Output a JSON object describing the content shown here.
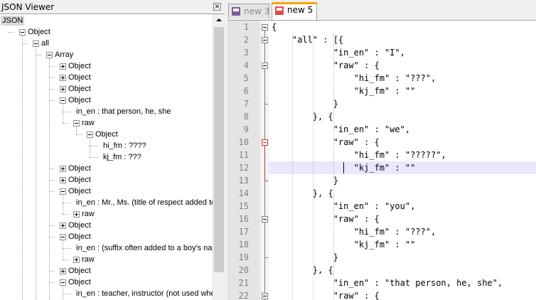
{
  "json_viewer": {
    "title": "JSON Viewer",
    "close_glyph": "×",
    "tree": [
      {
        "label": "JSON",
        "depth": 0,
        "toggle": "none",
        "root": true
      },
      {
        "label": "Object",
        "depth": 1,
        "toggle": "minus"
      },
      {
        "label": "all",
        "depth": 2,
        "toggle": "minus"
      },
      {
        "label": "Array",
        "depth": 3,
        "toggle": "minus"
      },
      {
        "label": "Object",
        "depth": 4,
        "toggle": "plus"
      },
      {
        "label": "Object",
        "depth": 4,
        "toggle": "plus"
      },
      {
        "label": "Object",
        "depth": 4,
        "toggle": "plus"
      },
      {
        "label": "Object",
        "depth": 4,
        "toggle": "minus"
      },
      {
        "label": "in_en : that person, he, she",
        "depth": 5,
        "toggle": "none"
      },
      {
        "label": "raw",
        "depth": 5,
        "toggle": "minus"
      },
      {
        "label": "Object",
        "depth": 6,
        "toggle": "minus"
      },
      {
        "label": "hi_fm : ????",
        "depth": 7,
        "toggle": "none"
      },
      {
        "label": "kj_fm : ???",
        "depth": 7,
        "toggle": "none"
      },
      {
        "label": "Object",
        "depth": 4,
        "toggle": "plus"
      },
      {
        "label": "Object",
        "depth": 4,
        "toggle": "plus"
      },
      {
        "label": "Object",
        "depth": 4,
        "toggle": "minus"
      },
      {
        "label": "in_en : Mr., Ms. (title of respect added to a",
        "depth": 5,
        "toggle": "none"
      },
      {
        "label": "raw",
        "depth": 5,
        "toggle": "plus"
      },
      {
        "label": "Object",
        "depth": 4,
        "toggle": "plus"
      },
      {
        "label": "Object",
        "depth": 4,
        "toggle": "minus"
      },
      {
        "label": "in_en : (suffix often added to a boy's name",
        "depth": 5,
        "toggle": "none"
      },
      {
        "label": "raw",
        "depth": 5,
        "toggle": "plus"
      },
      {
        "label": "Object",
        "depth": 4,
        "toggle": "plus"
      },
      {
        "label": "Object",
        "depth": 4,
        "toggle": "minus"
      },
      {
        "label": "in_en : teacher, instructor (not used when",
        "depth": 5,
        "toggle": "none"
      }
    ]
  },
  "tabs": [
    {
      "label": "new  3",
      "active": false
    },
    {
      "label": "new  5",
      "active": true
    }
  ],
  "editor": {
    "current_line": 12,
    "lines": [
      {
        "n": "1",
        "text": "{",
        "fold": "box"
      },
      {
        "n": "2",
        "text": "    \"all\" : [{",
        "fold": "box"
      },
      {
        "n": "3",
        "text": "            \"in_en\" : \"I\",",
        "fold": "line"
      },
      {
        "n": "4",
        "text": "            \"raw\" : {",
        "fold": "box"
      },
      {
        "n": "5",
        "text": "                \"hi_fm\" : \"???\",",
        "fold": "line"
      },
      {
        "n": "6",
        "text": "                \"kj_fm\" : \"\"",
        "fold": "line"
      },
      {
        "n": "7",
        "text": "            }",
        "fold": "end"
      },
      {
        "n": "8",
        "text": "        }, {",
        "fold": "line"
      },
      {
        "n": "9",
        "text": "            \"in_en\" : \"we\",",
        "fold": "line"
      },
      {
        "n": "10",
        "text": "            \"raw\" : {",
        "fold": "redbox"
      },
      {
        "n": "11",
        "text": "                \"hi_fm\" : \"?????\",",
        "fold": "redline"
      },
      {
        "n": "12",
        "text": "                \"kj_fm\" : \"\"",
        "fold": "redline"
      },
      {
        "n": "13",
        "text": "            }",
        "fold": "redend"
      },
      {
        "n": "14",
        "text": "        }, {",
        "fold": "line"
      },
      {
        "n": "15",
        "text": "            \"in_en\" : \"you\",",
        "fold": "line"
      },
      {
        "n": "16",
        "text": "            \"raw\" : {",
        "fold": "box"
      },
      {
        "n": "17",
        "text": "                \"hi_fm\" : \"???\",",
        "fold": "line"
      },
      {
        "n": "18",
        "text": "                \"kj_fm\" : \"\"",
        "fold": "line"
      },
      {
        "n": "19",
        "text": "            }",
        "fold": "end"
      },
      {
        "n": "20",
        "text": "        }, {",
        "fold": "line"
      },
      {
        "n": "21",
        "text": "            \"in_en\" : \"that person, he, she\",",
        "fold": "line"
      },
      {
        "n": "22",
        "text": "            \"raw\" : {",
        "fold": "box"
      }
    ]
  },
  "colors": {
    "active_tab_accent": "#f7a600",
    "current_line_bg": "#e8e8ff",
    "fold_highlight": "#d03030"
  }
}
